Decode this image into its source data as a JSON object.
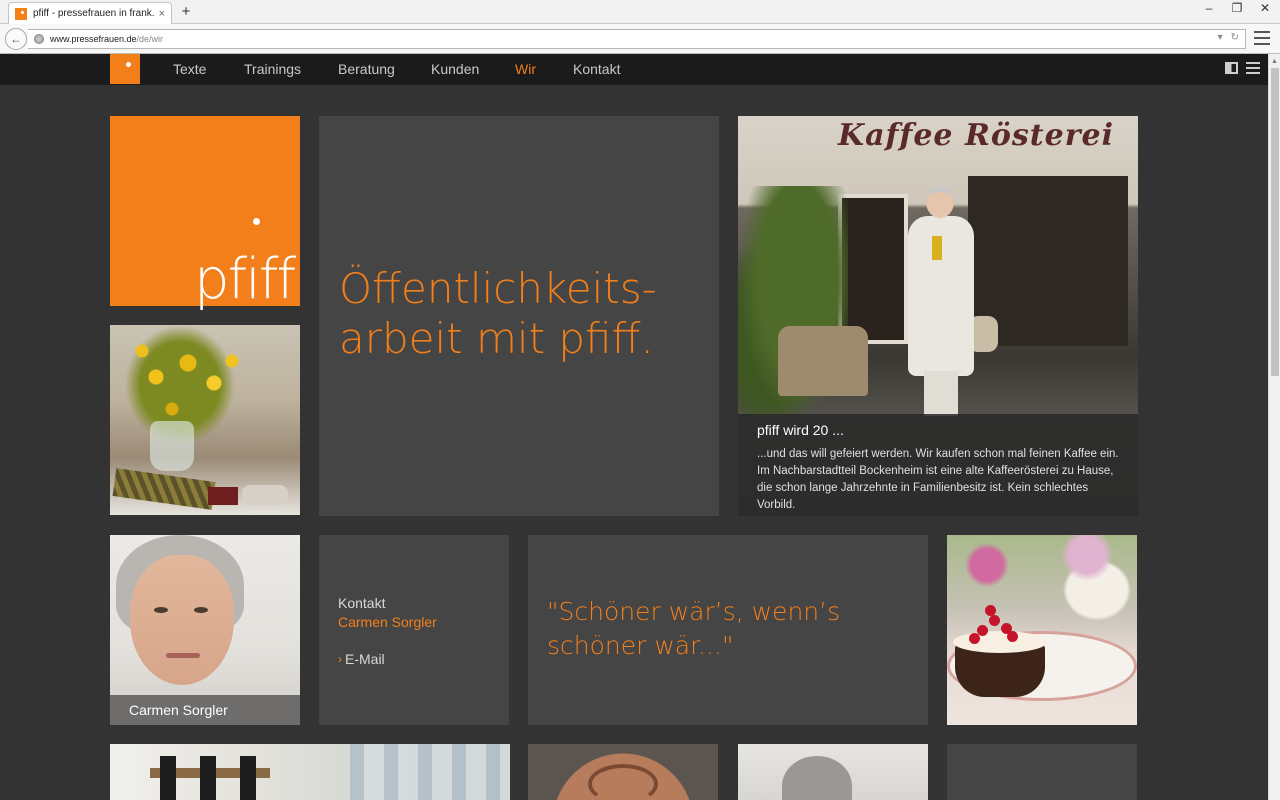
{
  "browser": {
    "tab_title": "pfiff - pressefrauen in frank...",
    "tab_close": "×",
    "new_tab": "+",
    "window_controls": [
      "–",
      "❐",
      "✕"
    ],
    "url_host": "www.pressefrauen.de",
    "url_path": "/de/wir"
  },
  "nav": {
    "items": [
      {
        "label": "Texte",
        "active": false
      },
      {
        "label": "Trainings",
        "active": false
      },
      {
        "label": "Beratung",
        "active": false
      },
      {
        "label": "Kunden",
        "active": false
      },
      {
        "label": "Wir",
        "active": true
      },
      {
        "label": "Kontakt",
        "active": false
      }
    ]
  },
  "logo": {
    "wordmark": "pfiff"
  },
  "headline": "Öffentlichkeits-arbeit mit pfiff.",
  "kaffee": {
    "sign": "Kaffee Rösterei",
    "title": "pfiff wird 20 ...",
    "text": "...und das will gefeiert werden. Wir kaufen schon mal feinen Kaffee ein. Im Nachbarstadtteil Bockenheim ist eine alte Kaffeerösterei zu Hause, die schon lange Jahrzehnte in Familienbesitz ist. Kein schlechtes Vorbild."
  },
  "portrait": {
    "name": "Carmen Sorgler"
  },
  "contact": {
    "label": "Kontakt",
    "name": "Carmen Sorgler",
    "email_chevron": "›",
    "email_label": "E-Mail"
  },
  "quote": "\"Schöner wär’s, wenn’s schöner wär...\"",
  "colors": {
    "accent": "#f37f1b",
    "nav_bg": "#1b1b1b",
    "page_bg": "#333333",
    "tile_bg": "#454545"
  },
  "icons": {
    "favicon": "pfiff-favicon",
    "back": "back-arrow-icon",
    "reload": "reload-icon",
    "menu": "hamburger-icon",
    "nav_toggle": "panel-toggle-icon"
  }
}
